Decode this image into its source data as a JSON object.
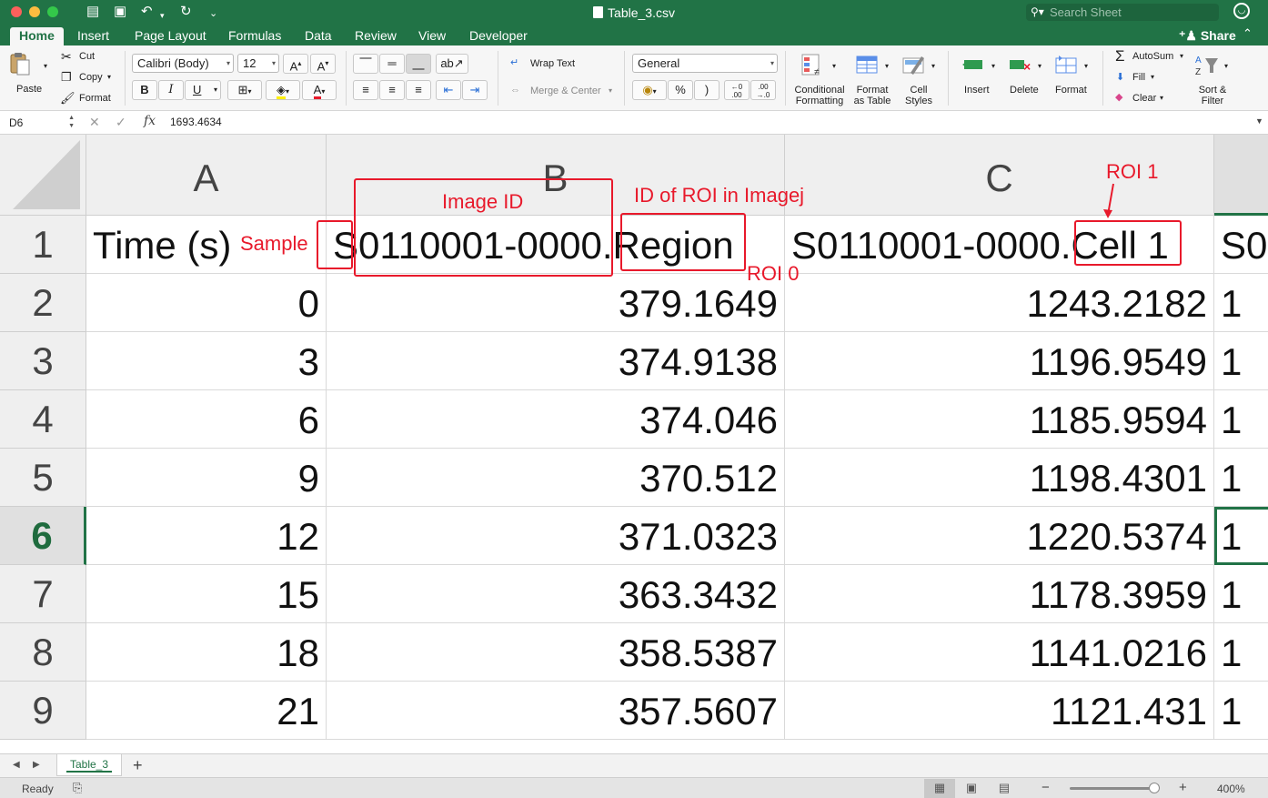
{
  "window": {
    "title": "Table_3.csv",
    "search_placeholder": "Search Sheet",
    "share_label": "Share"
  },
  "tabs": [
    "Home",
    "Insert",
    "Page Layout",
    "Formulas",
    "Data",
    "Review",
    "View",
    "Developer"
  ],
  "ribbon": {
    "paste": "Paste",
    "cut": "Cut",
    "copy": "Copy",
    "format_painter": "Format",
    "font_name": "Calibri (Body)",
    "font_size": "12",
    "bold": "B",
    "italic": "I",
    "underline": "U",
    "wrap_text": "Wrap Text",
    "merge_center": "Merge & Center",
    "number_format": "General",
    "percent": "%",
    "comma": ")",
    "cond_format_1": "Conditional",
    "cond_format_2": "Formatting",
    "format_table_1": "Format",
    "format_table_2": "as Table",
    "cell_styles_1": "Cell",
    "cell_styles_2": "Styles",
    "insert": "Insert",
    "delete": "Delete",
    "format": "Format",
    "autosum": "AutoSum",
    "fill": "Fill",
    "clear": "Clear",
    "sort_filter_1": "Sort &",
    "sort_filter_2": "Filter"
  },
  "formula_bar": {
    "cell_ref": "D6",
    "formula": "1693.4634",
    "fx": "fx"
  },
  "grid": {
    "columns": [
      "A",
      "B",
      "C"
    ],
    "row_numbers": [
      "1",
      "2",
      "3",
      "4",
      "5",
      "6",
      "7",
      "8",
      "9"
    ],
    "header_row": {
      "a": "Time (s)",
      "b": "S0110001-0000.Region",
      "c": "S0110001-0000.Cell 1",
      "d": "S0"
    },
    "rows": [
      {
        "a": "0",
        "b": "379.1649",
        "c": "1243.2182",
        "d": "1"
      },
      {
        "a": "3",
        "b": "374.9138",
        "c": "1196.9549",
        "d": "1"
      },
      {
        "a": "6",
        "b": "374.046",
        "c": "1185.9594",
        "d": "1"
      },
      {
        "a": "9",
        "b": "370.512",
        "c": "1198.4301",
        "d": "1"
      },
      {
        "a": "12",
        "b": "371.0323",
        "c": "1220.5374",
        "d": "1"
      },
      {
        "a": "15",
        "b": "363.3432",
        "c": "1178.3959",
        "d": "1"
      },
      {
        "a": "18",
        "b": "358.5387",
        "c": "1141.0216",
        "d": "1"
      },
      {
        "a": "21",
        "b": "357.5607",
        "c": "1121.431",
        "d": "1"
      }
    ]
  },
  "annotations": {
    "sample": "Sample",
    "image_id": "Image ID",
    "roi_id": "ID of ROI in Imagej",
    "roi1": "ROI 1",
    "roi0": "ROI 0",
    "color": "#e8192b"
  },
  "sheets": {
    "active": "Table_3",
    "add": "+"
  },
  "status": {
    "text": "Ready",
    "zoom": "400%"
  },
  "colors": {
    "brand": "#217346",
    "annotation": "#e8192b"
  }
}
